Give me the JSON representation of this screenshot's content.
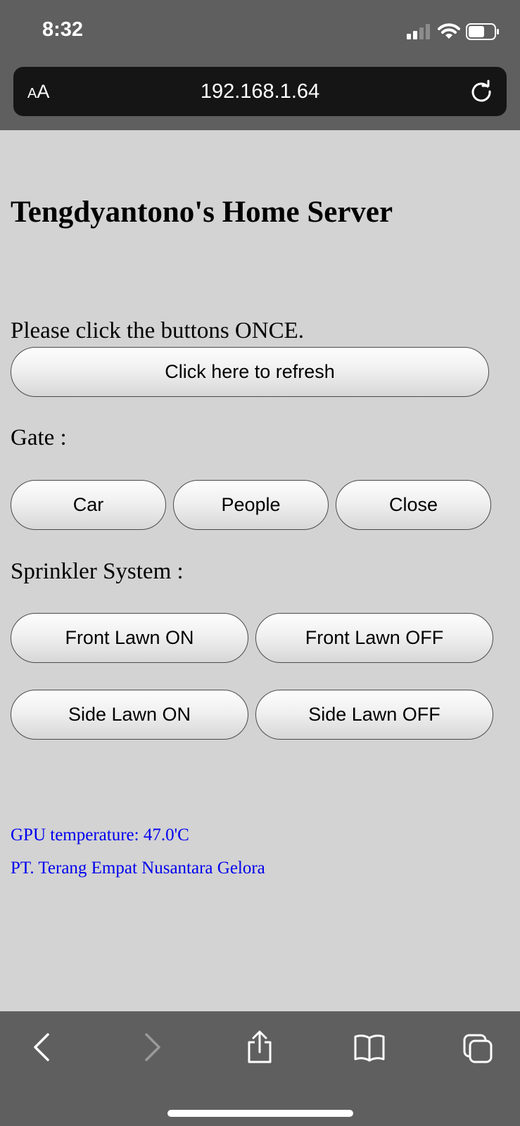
{
  "status_bar": {
    "time": "8:32"
  },
  "browser": {
    "text_size_label_small": "A",
    "text_size_label_large": "A",
    "url": "192.168.1.64"
  },
  "page": {
    "title": "Tengdyantono's Home Server",
    "instruction": "Please click the buttons ONCE.",
    "refresh_button": "Click here to refresh",
    "gate": {
      "label": "Gate :",
      "buttons": [
        "Car",
        "People",
        "Close"
      ]
    },
    "sprinkler": {
      "label": "Sprinkler System :",
      "front_on": "Front Lawn ON",
      "front_off": "Front Lawn OFF",
      "side_on": "Side Lawn ON",
      "side_off": "Side Lawn OFF"
    },
    "footer": {
      "gpu_temperature": "GPU temperature: 47.0'C",
      "company": "PT. Terang Empat Nusantara Gelora"
    }
  },
  "toolbar": {
    "icons": [
      "back-icon",
      "forward-icon",
      "share-icon",
      "bookmarks-icon",
      "tabs-icon"
    ]
  }
}
